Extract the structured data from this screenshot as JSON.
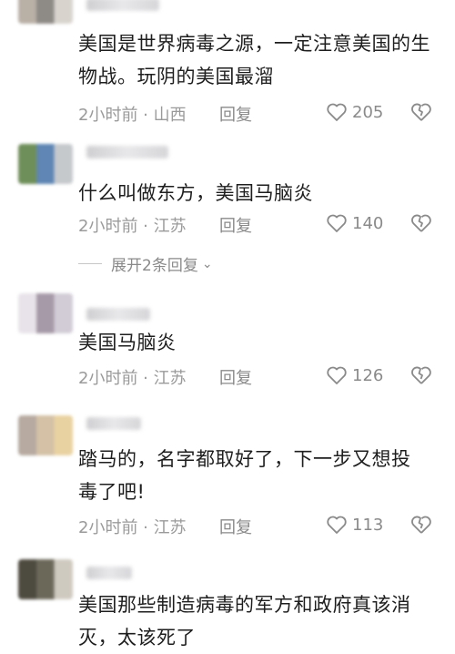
{
  "comments": [
    {
      "text": "美国是世界病毒之源，一定注意美国的生物战。玩阴的美国最溜",
      "time": "2小时前 · 山西",
      "reply_label": "回复",
      "likes": "205"
    },
    {
      "text": "什么叫做东方，美国马脑炎",
      "time": "2小时前 · 江苏",
      "reply_label": "回复",
      "likes": "140",
      "expand_label": "展开2条回复"
    },
    {
      "text": "美国马脑炎",
      "time": "2小时前 · 江苏",
      "reply_label": "回复",
      "likes": "126"
    },
    {
      "text": "踏马的，名字都取好了，下一步又想投毒了吧!",
      "time": "2小时前 · 江苏",
      "reply_label": "回复",
      "likes": "113"
    },
    {
      "text": "美国那些制造病毒的军方和政府真该消灭，太该死了",
      "time": "",
      "reply_label": "",
      "likes": ""
    }
  ],
  "icons": {
    "like": "heart-outline-icon",
    "dislike": "broken-heart-icon",
    "expand": "chevron-down-icon"
  },
  "colors": {
    "meta": "#9a9a9a",
    "text": "#1e1e1e"
  }
}
